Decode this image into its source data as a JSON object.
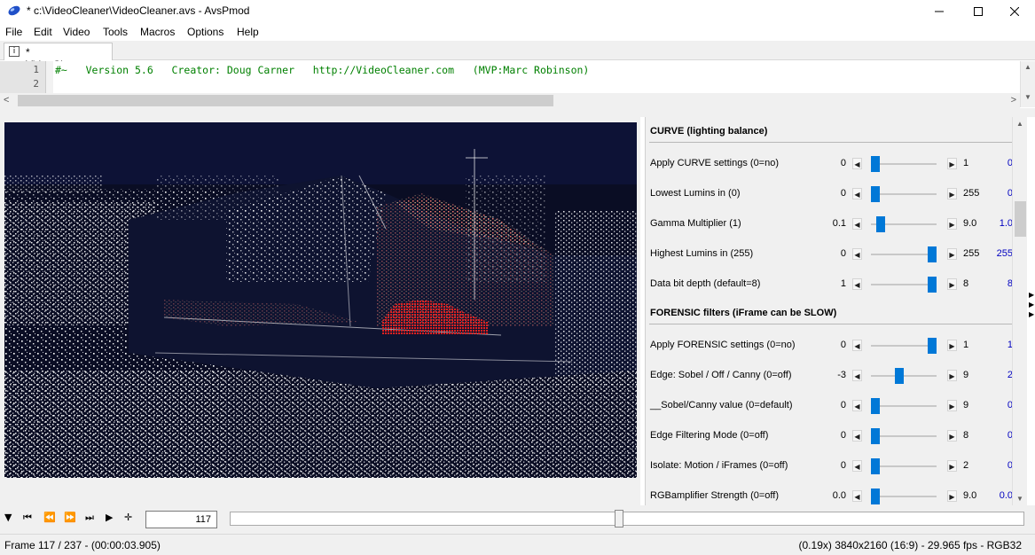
{
  "window": {
    "title": "* c:\\VideoCleaner\\VideoCleaner.avs - AvsPmod",
    "minimize": "—",
    "maximize": "☐",
    "close": "✕"
  },
  "menu": [
    "File",
    "Edit",
    "Video",
    "Tools",
    "Macros",
    "Options",
    "Help"
  ],
  "tab": {
    "label": "* VideoCleaner.avs",
    "icon": "script-file-icon"
  },
  "editor": {
    "line_numbers": [
      "1",
      "2"
    ],
    "lines": [
      "#~   Version 5.6   Creator: Doug Carner   http://VideoCleaner.com   (MVP:Marc Robinson)",
      ""
    ]
  },
  "sections": [
    {
      "title": "CURVE (lighting balance)",
      "rows": [
        {
          "label": "Apply CURVE settings (0=no)",
          "min": "0",
          "max": "1",
          "value": "0",
          "fraction": 0.0
        },
        {
          "label": "Lowest Lumins in (0)",
          "min": "0",
          "max": "255",
          "value": "0",
          "fraction": 0.0
        },
        {
          "label": "Gamma Multiplier (1)",
          "min": "0.1",
          "max": "9.0",
          "value": "1.0",
          "fraction": 0.1
        },
        {
          "label": "Highest Lumins in (255)",
          "min": "0",
          "max": "255",
          "value": "255",
          "fraction": 1.0
        },
        {
          "label": "Data bit depth (default=8)",
          "min": "1",
          "max": "8",
          "value": "8",
          "fraction": 1.0
        }
      ]
    },
    {
      "title": "FORENSIC filters (iFrame can be SLOW)",
      "rows": [
        {
          "label": "Apply FORENSIC settings (0=no)",
          "min": "0",
          "max": "1",
          "value": "1",
          "fraction": 1.0
        },
        {
          "label": "Edge: Sobel / Off / Canny (0=off)",
          "min": "-3",
          "max": "9",
          "value": "2",
          "fraction": 0.42
        },
        {
          "label": "__Sobel/Canny value (0=default)",
          "min": "0",
          "max": "9",
          "value": "0",
          "fraction": 0.0
        },
        {
          "label": "Edge Filtering Mode (0=off)",
          "min": "0",
          "max": "8",
          "value": "0",
          "fraction": 0.0
        },
        {
          "label": "Isolate: Motion / iFrames (0=off)",
          "min": "0",
          "max": "2",
          "value": "0",
          "fraction": 0.0
        },
        {
          "label": "RGBamplifier Strength (0=off)",
          "min": "0.0",
          "max": "9.0",
          "value": "0.0",
          "fraction": 0.0
        }
      ]
    }
  ],
  "playback": {
    "buttons": [
      "menu-triangle-icon",
      "first-frame-icon",
      "prev-frame-icon",
      "next-frame-icon",
      "last-frame-icon",
      "play-icon",
      "crosshair-icon"
    ],
    "frame_input": "117",
    "seek_fraction": 0.49
  },
  "status": {
    "left": "Frame 117 / 237  -  (00:00:03.905)",
    "right": "(0.19x)  3840x2160 (16:9)  -  29.965 fps  -  RGB32"
  },
  "colors": {
    "accent": "#0078d7",
    "value_blue": "#0000c0",
    "code_green": "#008000"
  }
}
